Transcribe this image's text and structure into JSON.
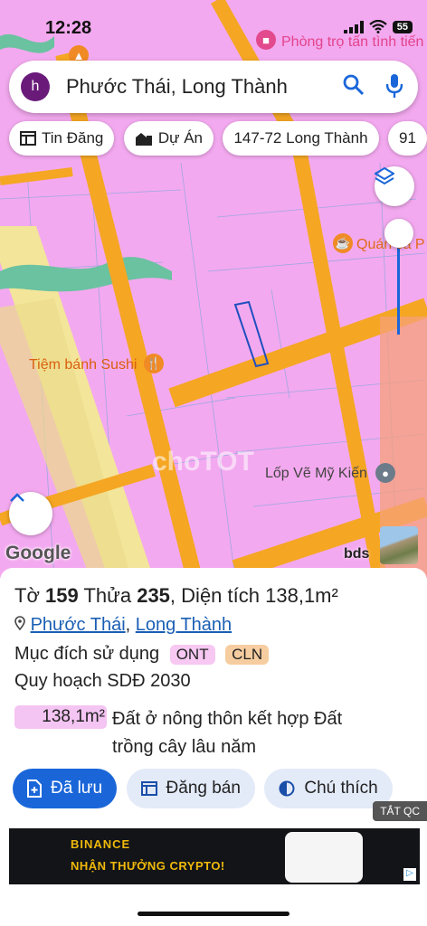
{
  "status_bar": {
    "time": "12:28",
    "battery": "55"
  },
  "search": {
    "avatar_letter": "h",
    "query": "Phước Thái, Long Thành"
  },
  "chips": [
    {
      "icon": "newspaper-icon",
      "label": "Tin Đăng"
    },
    {
      "icon": "buildings-icon",
      "label": "Dự Án"
    },
    {
      "icon": "",
      "label": "147-72 Long Thành"
    },
    {
      "icon": "",
      "label": "91"
    }
  ],
  "map": {
    "labels": {
      "lodging": "Phòng trọ tấn tình tiến",
      "cafe": "Quán cà P",
      "bakery": "Tiệm bánh Sushi",
      "tire": "Lốp Vẽ Mỹ Kiến"
    },
    "attribution": "Google",
    "provider": "bds",
    "watermark": "choTOT"
  },
  "parcel": {
    "sheet_label": "Tờ",
    "sheet_no": "159",
    "plot_label": "Thửa",
    "plot_no": "235",
    "area_label": "Diện tích",
    "area": "138,1m²",
    "ward": "Phước Thái",
    "district": "Long Thành",
    "purpose_label": "Mục đích sử dụng",
    "purpose_tags": [
      "ONT",
      "CLN"
    ],
    "plan": "Quy hoạch SDĐ 2030",
    "plan_area": "138,1m²",
    "plan_desc": "Đất ở nông thôn kết hợp Đất trồng cây lâu năm"
  },
  "actions": {
    "saved": "Đã lưu",
    "post": "Đăng bán",
    "legend": "Chú thích"
  },
  "ad": {
    "close_label": "TẮT QC",
    "brand": "BINANCE",
    "headline": "NHẬN THƯỞNG CRYPTO!"
  },
  "colors": {
    "primary": "#1a66d9",
    "road": "#f5a623",
    "land": "#f3a9ef"
  }
}
